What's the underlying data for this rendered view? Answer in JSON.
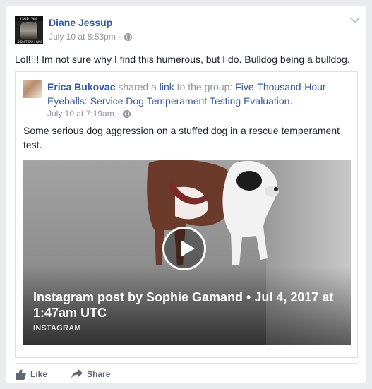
{
  "post": {
    "author": "Diane Jessup",
    "date": "July 10 at 8:53pm",
    "separator": "·",
    "avatar_top_text": "I SAID I WAS AWESOME",
    "avatar_bottom_text": "I DIDN'T SAY I WAS MY SHIT TOGETHER",
    "text": "Lol!!!! Im not sure why I find this humerous, but I do. Bulldog being a bulldog."
  },
  "shared": {
    "sharer": "Erica Bukovac",
    "shared_word": "shared a",
    "link_word": "link",
    "to_word": "to the group:",
    "group": "Five-Thousand-Hour Eyeballs: Service Dog Temperament Testing Evaluation.",
    "date": "July 10 at 7:19am",
    "separator": "·",
    "text": "Some serious dog aggression on a stuffed dog in a rescue temperament test.",
    "media": {
      "title": "Instagram post by Sophie Gamand • Jul 4, 2017 at 1:47am UTC",
      "source": "INSTAGRAM"
    }
  },
  "actions": {
    "like": "Like",
    "share": "Share"
  },
  "colors": {
    "link_blue": "#365899",
    "meta_gray": "#90949c",
    "action_gray": "#606770"
  }
}
